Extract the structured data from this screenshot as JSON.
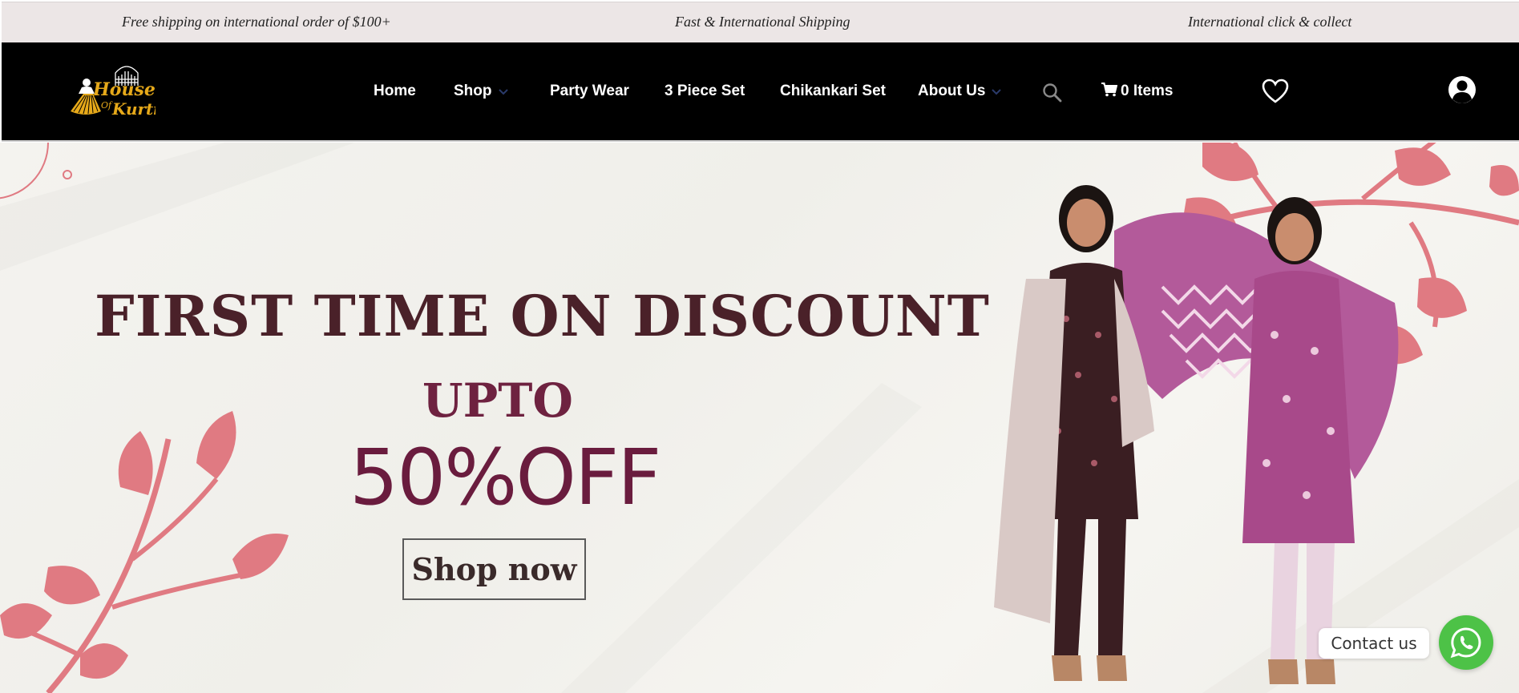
{
  "announcements": [
    "Free shipping on international order of $100+",
    "Fast & International Shipping",
    "International click & collect"
  ],
  "brand": {
    "logo_text_top": "House",
    "logo_text_mid": "Of",
    "logo_text_bottom": "Kurti",
    "logo_color": "#e6a91a"
  },
  "nav": {
    "home": "Home",
    "shop": "Shop",
    "party_wear": "Party Wear",
    "three_piece": "3 Piece Set",
    "chikankari": "Chikankari Set",
    "about": "About Us"
  },
  "cart": {
    "label": "0 Items"
  },
  "hero": {
    "title": "FIRST TIME ON DISCOUNT",
    "upto": "UPTO",
    "offer": "50%OFF",
    "cta": "Shop now"
  },
  "contact": {
    "label": "Contact us"
  },
  "colors": {
    "header_bg": "#000000",
    "topbar_bg": "#ece6e6",
    "accent_maroon": "#6a1c3e",
    "leaf_pink": "#e07a82",
    "whatsapp_green": "#4dc247"
  },
  "icons": [
    "search-icon",
    "cart-icon",
    "heart-icon",
    "user-icon",
    "whatsapp-icon",
    "chevron-down-icon"
  ]
}
